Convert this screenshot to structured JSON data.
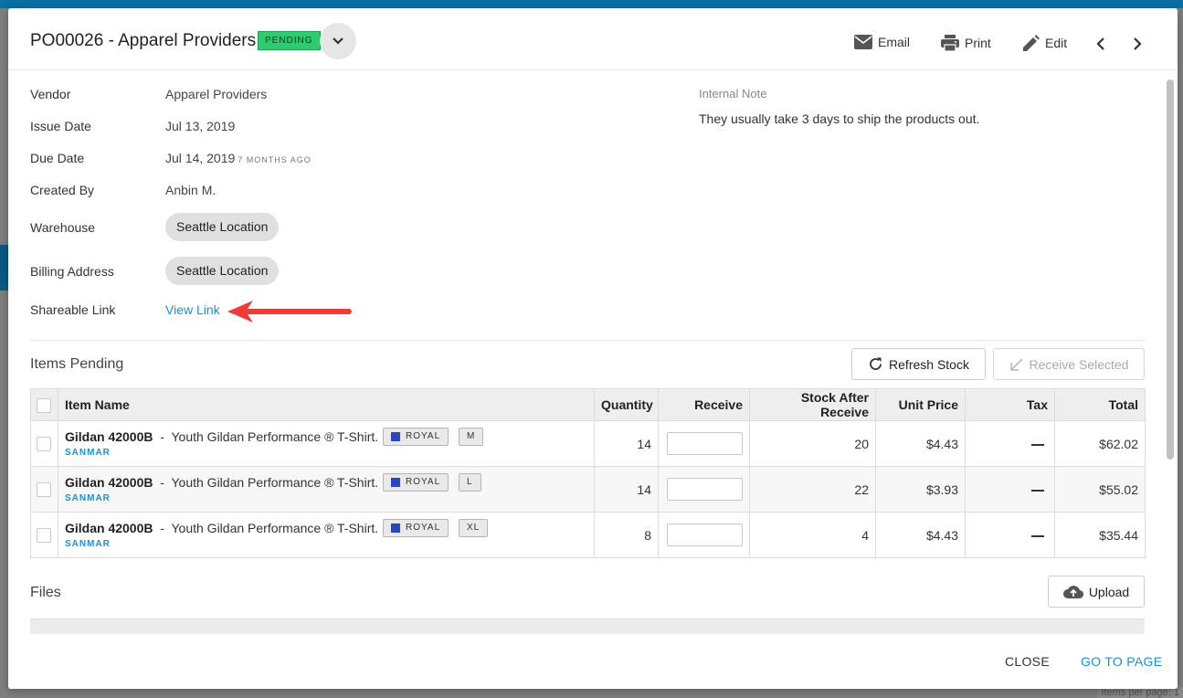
{
  "header": {
    "title": "PO00026 - Apparel Providers",
    "status": "PENDING",
    "actions": {
      "email": "Email",
      "print": "Print",
      "edit": "Edit"
    }
  },
  "details": {
    "vendor": {
      "label": "Vendor",
      "value": "Apparel Providers"
    },
    "issue_date": {
      "label": "Issue Date",
      "value": "Jul 13, 2019"
    },
    "due_date": {
      "label": "Due Date",
      "value": "Jul 14, 2019",
      "relative": "7 MONTHS AGO"
    },
    "created_by": {
      "label": "Created By",
      "value": "Anbin M."
    },
    "warehouse": {
      "label": "Warehouse",
      "value": "Seattle Location"
    },
    "billing_address": {
      "label": "Billing Address",
      "value": "Seattle Location"
    },
    "shareable_link": {
      "label": "Shareable Link",
      "value": "View Link"
    }
  },
  "internal_note": {
    "label": "Internal Note",
    "text": "They usually take 3 days to ship the products out."
  },
  "items": {
    "title": "Items Pending",
    "refresh_label": "Refresh Stock",
    "receive_selected_label": "Receive Selected",
    "columns": [
      "Item Name",
      "Quantity",
      "Receive",
      "Stock After Receive",
      "Unit Price",
      "Tax",
      "Total"
    ],
    "rows": [
      {
        "sku": "Gildan 42000B",
        "sep": "-",
        "desc": "Youth Gildan Performance ® T-Shirt.",
        "color": "ROYAL",
        "size": "M",
        "brand": "SANMAR",
        "quantity": "14",
        "stock_after": "20",
        "unit_price": "$4.43",
        "total": "$62.02"
      },
      {
        "sku": "Gildan 42000B",
        "sep": "-",
        "desc": "Youth Gildan Performance ® T-Shirt.",
        "color": "ROYAL",
        "size": "L",
        "brand": "SANMAR",
        "quantity": "14",
        "stock_after": "22",
        "unit_price": "$3.93",
        "total": "$55.02"
      },
      {
        "sku": "Gildan 42000B",
        "sep": "-",
        "desc": "Youth Gildan Performance ® T-Shirt.",
        "color": "ROYAL",
        "size": "XL",
        "brand": "SANMAR",
        "quantity": "8",
        "stock_after": "4",
        "unit_price": "$4.43",
        "total": "$35.44"
      }
    ]
  },
  "files": {
    "title": "Files",
    "upload_label": "Upload"
  },
  "footer": {
    "close": "CLOSE",
    "go_to_page": "GO TO PAGE"
  },
  "background": {
    "footer_text": "Items per page: 1"
  },
  "colors": {
    "accent": "#1a8fd6",
    "pending": "#2ecc71",
    "annotation_arrow": "#ef3b3b",
    "swatch_royal": "#2a46b8"
  },
  "icons": [
    "chevron-down-icon",
    "email-icon",
    "print-icon",
    "edit-icon",
    "chevron-left-icon",
    "chevron-right-icon",
    "refresh-icon",
    "receive-icon",
    "upload-icon",
    "dash-icon"
  ]
}
